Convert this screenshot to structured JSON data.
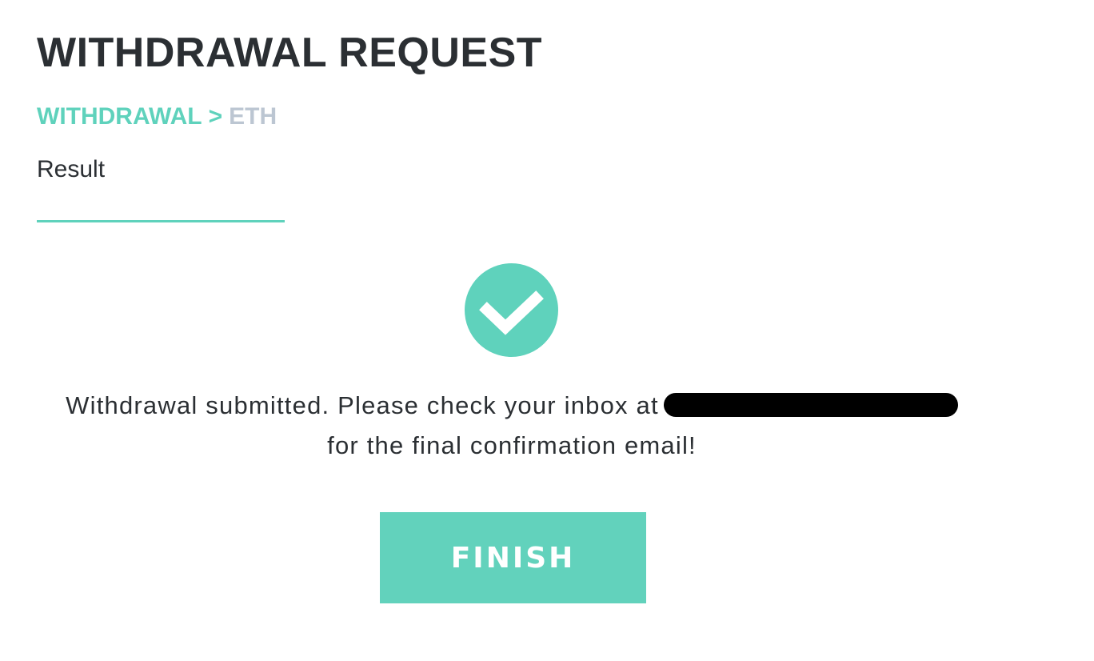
{
  "header": {
    "title": "WITHDRAWAL REQUEST"
  },
  "breadcrumb": {
    "parent": "WITHDRAWAL",
    "separator": ">",
    "current": "ETH"
  },
  "step": {
    "label": "Result"
  },
  "result": {
    "icon": "check-circle-icon",
    "message_line1": "Withdrawal submitted. Please check your inbox at",
    "message_line2": "for the final confirmation email!"
  },
  "actions": {
    "finish_label": "FINISH"
  },
  "colors": {
    "accent": "#5fd2bc",
    "title": "#2b2f33",
    "muted": "#bcc6d2",
    "redaction": "#000000"
  }
}
